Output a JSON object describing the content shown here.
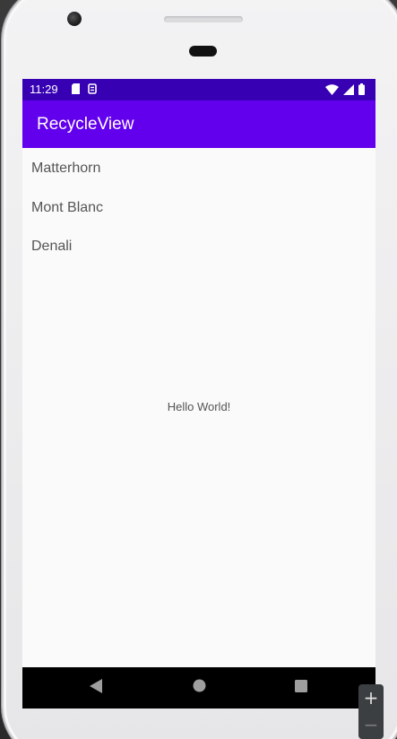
{
  "status_bar": {
    "time": "11:29",
    "left_icons": [
      "sd-card-icon",
      "notification-icon"
    ],
    "right_icons": [
      "wifi-icon",
      "cell-signal-icon",
      "battery-icon"
    ]
  },
  "app_bar": {
    "title": "RecycleView"
  },
  "list": {
    "items": [
      {
        "label": "Matterhorn"
      },
      {
        "label": "Mont Blanc"
      },
      {
        "label": "Denali"
      }
    ]
  },
  "content": {
    "center_text": "Hello World!"
  },
  "nav_bar": {
    "buttons": [
      "back-icon",
      "home-icon",
      "recents-icon"
    ]
  },
  "zoom_controls": {
    "zoom_in_label": "+",
    "zoom_out_label": "−"
  },
  "colors": {
    "status_bar": "#3700b3",
    "app_bar": "#6200ee",
    "screen_background": "#fafafa",
    "text": "#555555",
    "nav_bar": "#000000"
  }
}
